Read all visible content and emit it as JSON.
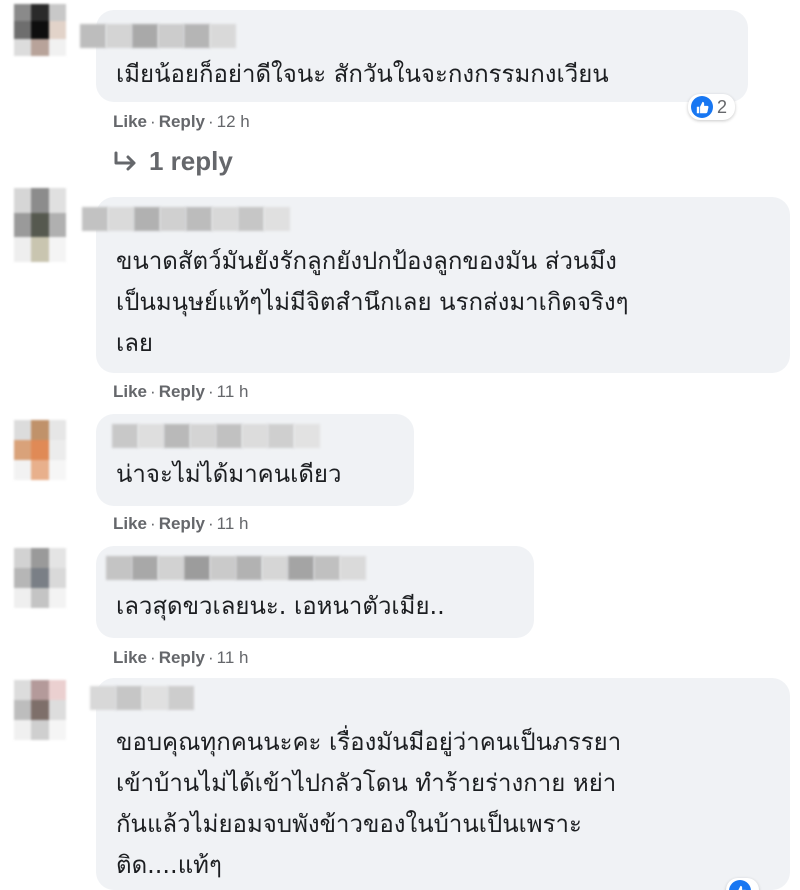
{
  "comments": [
    {
      "text": "เมียน้อยก็อย่าดีใจนะ สักวันในจะกงกรรมกงเวียน",
      "like": "Like",
      "reply": "Reply",
      "time": "12 h",
      "reaction_count": "2",
      "replies_link": "1 reply"
    },
    {
      "text": "ขนาดสัตว์มันยังรักลูกยังปกป้องลูกของมัน ส่วนมึง\nเป็นมนุษย์แท้ๆไม่มีจิตสำนึกเลย นรกส่งมาเกิดจริงๆ\nเลย",
      "like": "Like",
      "reply": "Reply",
      "time": "11 h"
    },
    {
      "text": "น่าจะไม่ได้มาคนเดียว",
      "like": "Like",
      "reply": "Reply",
      "time": "11 h"
    },
    {
      "text": "เลวสุดขวเลยนะ. เอหนาตัวเมีย..",
      "like": "Like",
      "reply": "Reply",
      "time": "11 h"
    },
    {
      "text": "ขอบคุณทุกคนนะคะ เรื่องมันมีอยู่ว่าคนเป็นภรรยา\nเข้าบ้านไม่ได้เข้าไปกลัวโดน ทำร้ายร่างกาย หย่า\nกันแล้วไม่ยอมจบพังข้าวของในบ้านเป็นเพราะ\nติด....แท้ๆ"
    }
  ],
  "colors": {
    "bubble": "#f0f2f5",
    "text": "#1c1e21",
    "meta": "#65676b",
    "like_blue": "#1877f2"
  },
  "icons": {
    "reaction": "like-thumb-icon",
    "reply_arrow": "reply-arrow-icon"
  }
}
